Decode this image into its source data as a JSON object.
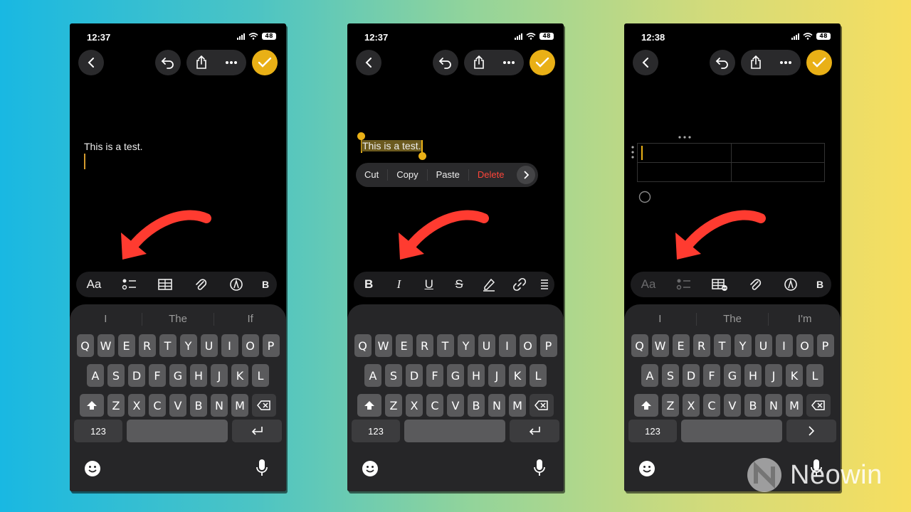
{
  "phones": [
    {
      "time": "12:37",
      "battery": "48",
      "note_text": "This is a test.",
      "suggestions": [
        "I",
        "The",
        "If"
      ],
      "toolbar": {
        "text_style_label": "Aa"
      },
      "keyboard": {
        "row1": [
          "Q",
          "W",
          "E",
          "R",
          "T",
          "Y",
          "U",
          "I",
          "O",
          "P"
        ],
        "row2": [
          "A",
          "S",
          "D",
          "F",
          "G",
          "H",
          "J",
          "K",
          "L"
        ],
        "row3": [
          "Z",
          "X",
          "C",
          "V",
          "B",
          "N",
          "M"
        ],
        "numbers_label": "123"
      }
    },
    {
      "time": "12:37",
      "battery": "48",
      "note_text": "This is a test.",
      "context_menu": [
        "Cut",
        "Copy",
        "Paste",
        "Delete"
      ],
      "suggestions": [
        "",
        "",
        ""
      ],
      "format_bar": {
        "bold": "B",
        "italic": "I",
        "underline": "U",
        "strike": "S"
      },
      "keyboard": {
        "row1": [
          "Q",
          "W",
          "E",
          "R",
          "T",
          "Y",
          "U",
          "I",
          "O",
          "P"
        ],
        "row2": [
          "A",
          "S",
          "D",
          "F",
          "G",
          "H",
          "J",
          "K",
          "L"
        ],
        "row3": [
          "Z",
          "X",
          "C",
          "V",
          "B",
          "N",
          "M"
        ],
        "numbers_label": "123"
      }
    },
    {
      "time": "12:38",
      "battery": "48",
      "suggestions": [
        "I",
        "The",
        "I'm"
      ],
      "toolbar": {
        "text_style_label": "Aa"
      },
      "keyboard": {
        "row1": [
          "Q",
          "W",
          "E",
          "R",
          "T",
          "Y",
          "U",
          "I",
          "O",
          "P"
        ],
        "row2": [
          "A",
          "S",
          "D",
          "F",
          "G",
          "H",
          "J",
          "K",
          "L"
        ],
        "row3": [
          "Z",
          "X",
          "C",
          "V",
          "B",
          "N",
          "M"
        ],
        "numbers_label": "123"
      }
    }
  ],
  "watermark": "Neowin",
  "colors": {
    "accent": "#e9b016",
    "arrow": "#ff3b30",
    "delete": "#ff453a"
  }
}
